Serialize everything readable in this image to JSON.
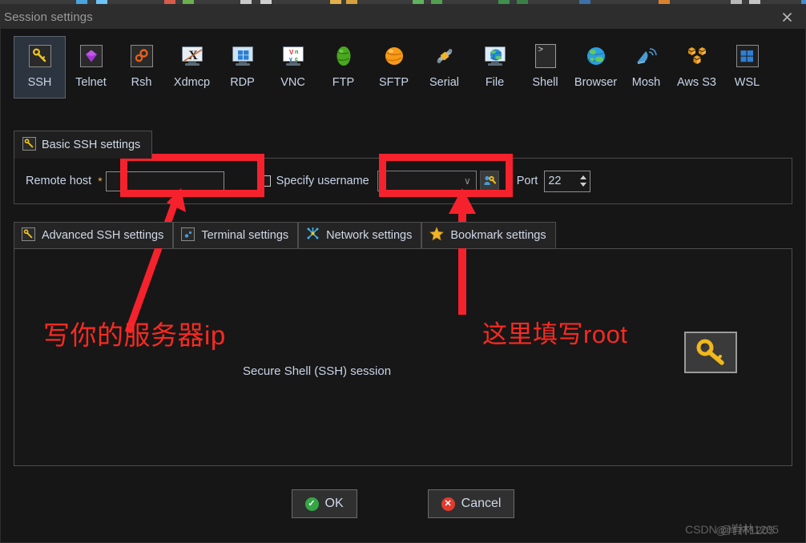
{
  "window": {
    "title": "Session settings",
    "close_icon": "close-icon"
  },
  "protocols": [
    {
      "label": "SSH",
      "icon": "ssh-key-icon",
      "selected": true
    },
    {
      "label": "Telnet",
      "icon": "telnet-gem-icon",
      "selected": false
    },
    {
      "label": "Rsh",
      "icon": "rsh-gears-icon",
      "selected": false
    },
    {
      "label": "Xdmcp",
      "icon": "xdmcp-monitor-icon",
      "selected": false
    },
    {
      "label": "RDP",
      "icon": "rdp-windows-icon",
      "selected": false
    },
    {
      "label": "VNC",
      "icon": "vnc-monitor-icon",
      "selected": false
    },
    {
      "label": "FTP",
      "icon": "ftp-green-globe-icon",
      "selected": false
    },
    {
      "label": "SFTP",
      "icon": "sftp-orange-globe-icon",
      "selected": false
    },
    {
      "label": "Serial",
      "icon": "serial-plug-icon",
      "selected": false
    },
    {
      "label": "File",
      "icon": "file-globe-monitor-icon",
      "selected": false
    },
    {
      "label": "Shell",
      "icon": "shell-prompt-icon",
      "selected": false
    },
    {
      "label": "Browser",
      "icon": "browser-globe-icon",
      "selected": false
    },
    {
      "label": "Mosh",
      "icon": "mosh-satellite-icon",
      "selected": false
    },
    {
      "label": "Aws S3",
      "icon": "aws-s3-cubes-icon",
      "selected": false
    },
    {
      "label": "WSL",
      "icon": "wsl-windows-icon",
      "selected": false
    }
  ],
  "basic_group": {
    "tab_label": "Basic SSH settings",
    "tab_icon": "ssh-key-icon",
    "remote_host_label": "Remote host",
    "required_marker": "*",
    "remote_host_value": "",
    "remote_host_placeholder": "",
    "specify_username_label": "Specify username",
    "specify_username_checked": false,
    "username_value": "",
    "username_dropdown_icon": "chevron-down-icon",
    "key_button_icon": "user-key-icon",
    "port_label": "Port",
    "port_value": "22",
    "spinner_up_icon": "spinner-up-icon",
    "spinner_down_icon": "spinner-down-icon"
  },
  "lower_tabs": [
    {
      "label": "Advanced SSH settings",
      "icon": "ssh-key-icon"
    },
    {
      "label": "Terminal settings",
      "icon": "terminal-icon"
    },
    {
      "label": "Network settings",
      "icon": "network-nodes-icon"
    },
    {
      "label": "Bookmark settings",
      "icon": "star-icon"
    }
  ],
  "content": {
    "session_caption": "Secure Shell (SSH) session",
    "key_thumbnail_icon": "large-key-icon"
  },
  "footer": {
    "ok_label": "OK",
    "ok_icon": "check-circle-icon",
    "cancel_label": "Cancel",
    "cancel_icon": "x-circle-icon"
  },
  "watermark": {
    "text": "CSDN @肖林1205",
    "overlay_text": "@肖林1205"
  },
  "annotations": {
    "host_note": "写你的服务器ip",
    "user_note": "这里填写root",
    "accent_color": "#f5222d"
  }
}
